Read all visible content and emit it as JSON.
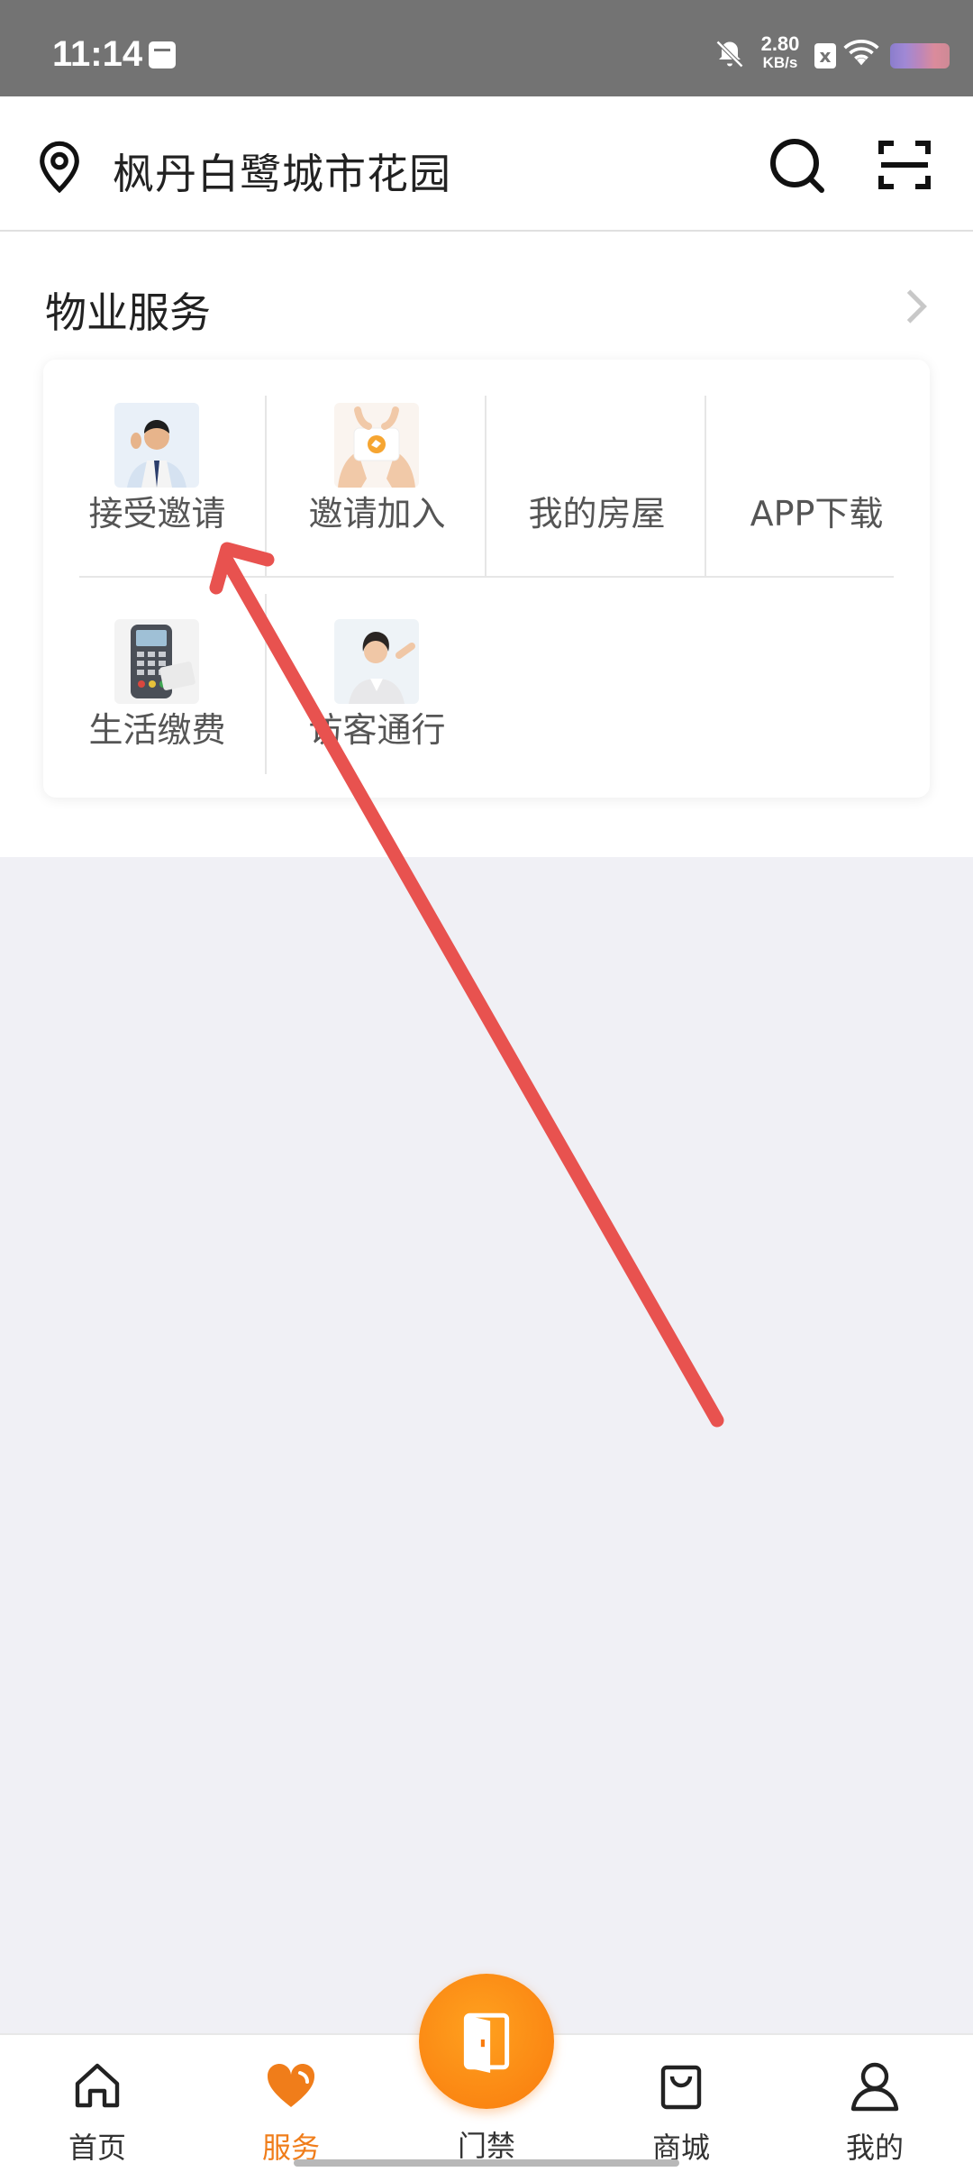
{
  "status_bar": {
    "time": "11:14",
    "net_speed_value": "2.80",
    "net_speed_unit": "KB/s",
    "sim_mark": "x",
    "icons": [
      "note-icon",
      "mute-icon",
      "sim-icon",
      "wifi-icon",
      "battery-icon"
    ]
  },
  "header": {
    "community_name": "枫丹白鹭城市花园",
    "icons": [
      "location-pin-icon",
      "search-icon",
      "scan-icon"
    ]
  },
  "services": {
    "section_title": "物业服务",
    "items": [
      {
        "label": "接受邀请",
        "icon": "businessman-thumbnail"
      },
      {
        "label": "邀请加入",
        "icon": "hands-card-thumbnail"
      },
      {
        "label": "我的房屋",
        "icon": ""
      },
      {
        "label": "APP下载",
        "icon": ""
      },
      {
        "label": "生活缴费",
        "icon": "card-reader-thumbnail"
      },
      {
        "label": "访客通行",
        "icon": "receptionist-thumbnail"
      }
    ]
  },
  "bottom_nav": {
    "items": [
      {
        "label": "首页",
        "icon": "home-icon",
        "active": false
      },
      {
        "label": "服务",
        "icon": "heart-icon",
        "active": true
      },
      {
        "label": "门禁",
        "icon": "door-icon",
        "active": false
      },
      {
        "label": "商城",
        "icon": "shopping-bag-icon",
        "active": false
      },
      {
        "label": "我的",
        "icon": "user-icon",
        "active": false
      }
    ]
  },
  "colors": {
    "accent": "#f07d1a",
    "arrow_annotation": "#e8524f",
    "status_bar": "#737373",
    "page_background": "#f0f0f5"
  }
}
